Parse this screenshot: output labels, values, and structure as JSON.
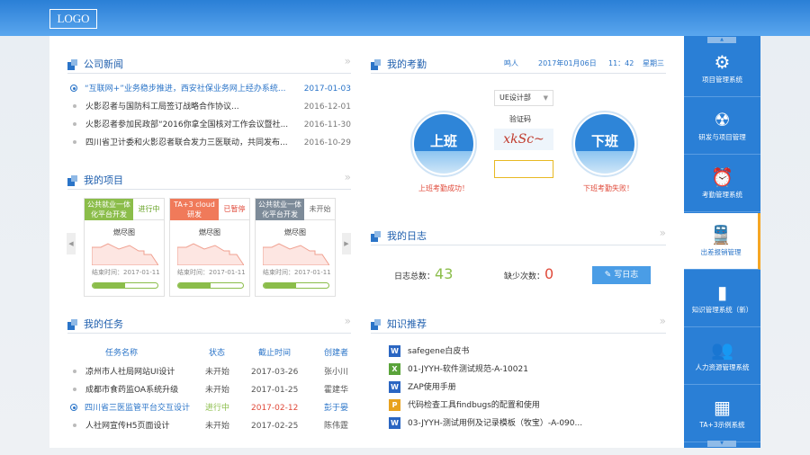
{
  "logo": "LOGO",
  "news": {
    "title": "公司新闻",
    "items": [
      {
        "text": "“互联网+”业务稳步推进，西安社保业务网上经办系统...",
        "date": "2017-01-03",
        "active": true
      },
      {
        "text": "火影忍者与国防科工局签订战略合作协议...",
        "date": "2016-12-01"
      },
      {
        "text": "火影忍者参加民政部“2016你拿全国核对工作会议暨社...",
        "date": "2016-11-30"
      },
      {
        "text": "四川省卫计委和火影忍者联合发力三医联动，共同发布...",
        "date": "2016-10-29"
      }
    ]
  },
  "projects": {
    "title": "我的项目",
    "cards": [
      {
        "name": "公共就业一体化平台开发",
        "status": "进行中",
        "chart_label": "燃尽图",
        "end": "结束时间：2017-01-11",
        "progress": 0.5,
        "tag_color": "#8bbd4a",
        "status_color": "#6aa42a"
      },
      {
        "name": "TA+3 cloud 研发",
        "status": "已暂停",
        "chart_label": "燃尽图",
        "end": "结束时间：2017-01-11",
        "progress": 0.5,
        "tag_color": "#f07a5a",
        "status_color": "#e04a3a"
      },
      {
        "name": "公共就业一体化平台开发",
        "status": "未开始",
        "chart_label": "燃尽图",
        "end": "结束时间：2017-01-11",
        "progress": 0.5,
        "tag_color": "#7d8b99",
        "status_color": "#666"
      }
    ]
  },
  "tasks": {
    "title": "我的任务",
    "headers": [
      "任务名称",
      "状态",
      "截止时间",
      "创建者"
    ],
    "rows": [
      {
        "name": "凉州市人社局网站UI设计",
        "status": "未开始",
        "date": "2017-03-26",
        "creator": "张小川"
      },
      {
        "name": "成都市食药监OA系统升级",
        "status": "未开始",
        "date": "2017-01-25",
        "creator": "霍建华"
      },
      {
        "name": "四川省三医监管平台交互设计",
        "status": "进行中",
        "date": "2017-02-12",
        "creator": "彭于晏",
        "active": true
      },
      {
        "name": "人社网宣传H5页面设计",
        "status": "未开始",
        "date": "2017-02-25",
        "creator": "陈伟霆"
      }
    ]
  },
  "attendance": {
    "title": "我的考勤",
    "user": "鸣人",
    "date": "2017年01月06日",
    "time": "11：42",
    "weekday": "星期三",
    "department": "UE设计部",
    "captcha_label": "验证码",
    "captcha_text": "xkSc~",
    "captcha_value": "",
    "checkin": "上班",
    "checkout": "下班",
    "checkin_msg": "上班考勤成功！",
    "checkout_msg": "下班考勤失败！"
  },
  "log": {
    "title": "我的日志",
    "total_label": "日志总数：",
    "total": "43",
    "missing_label": "缺少次数：",
    "missing": "0",
    "write": "写日志"
  },
  "knowledge": {
    "title": "知识推荐",
    "items": [
      {
        "type": "W",
        "text": "safegene白皮书"
      },
      {
        "type": "X",
        "text": "01-JYYH-软件测试规范-A-10021"
      },
      {
        "type": "W",
        "text": "ZAP使用手册"
      },
      {
        "type": "P",
        "text": "代码检查工具findbugs的配置和使用"
      },
      {
        "type": "W",
        "text": "03-JYYH-测试用例及记录模板（牧宝）-A-090..."
      }
    ]
  },
  "sidebar": {
    "items": [
      {
        "label": "项目管理系统",
        "icon": "gear-icon"
      },
      {
        "label": "研发与项目管理",
        "icon": "radiation-icon"
      },
      {
        "label": "考勤管理系统",
        "icon": "alarm-clock-icon"
      },
      {
        "label": "出差报销管理",
        "icon": "train-icon",
        "active": true
      },
      {
        "label": "知识管理系统（新）",
        "icon": "book-icon"
      },
      {
        "label": "人力资源管理系统",
        "icon": "users-icon"
      },
      {
        "label": "TA+3示例系统",
        "icon": "grid-icon"
      }
    ]
  },
  "colors": {
    "primary": "#2a7fd6",
    "accent": "#f5a623",
    "success": "#8bbd4a",
    "danger": "#e04a3a"
  }
}
